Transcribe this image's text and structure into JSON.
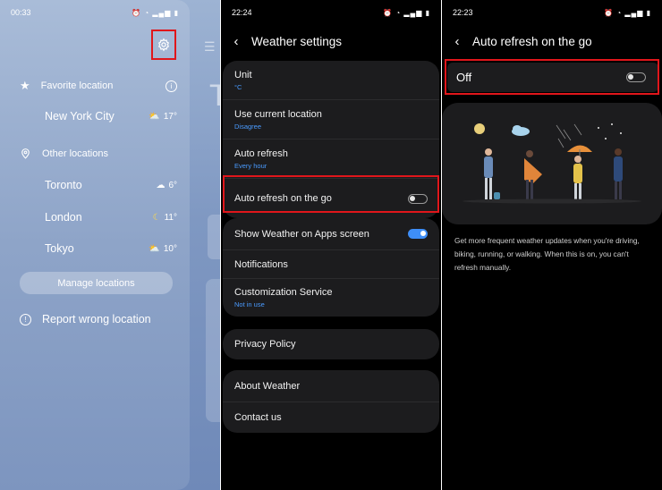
{
  "panel1": {
    "time": "00:33",
    "status_icons": "⏰ ◔ ▂▄▆ ▮",
    "favorite_label": "Favorite location",
    "favorite_city": "New York City",
    "favorite_temp": "17°",
    "other_label": "Other locations",
    "cities": [
      {
        "name": "Toronto",
        "temp": "6°",
        "icon": "cloud-icon"
      },
      {
        "name": "London",
        "temp": "11°",
        "icon": "moon-icon"
      },
      {
        "name": "Tokyo",
        "temp": "10°",
        "icon": "partly-cloudy-icon"
      }
    ],
    "manage_label": "Manage locations",
    "report_label": "Report wrong location"
  },
  "panel2": {
    "time": "22:24",
    "title": "Weather settings",
    "rows": [
      {
        "title": "Unit",
        "sub": "°C"
      },
      {
        "title": "Use current location",
        "sub": "Disagree"
      },
      {
        "title": "Auto refresh",
        "sub": "Every hour"
      },
      {
        "title": "Auto refresh on the go"
      }
    ],
    "show_on_apps": "Show Weather on Apps screen",
    "notifications": "Notifications",
    "customization": "Customization Service",
    "customization_sub": "Not in use",
    "privacy": "Privacy Policy",
    "about": "About Weather",
    "contact": "Contact us"
  },
  "panel3": {
    "time": "22:23",
    "title": "Auto refresh on the go",
    "off_label": "Off",
    "description": "Get more frequent weather updates when you're driving, biking, running, or walking. When this is on, you can't refresh manually."
  },
  "colors": {
    "accent": "#3e8ef7",
    "highlight": "#e0161b",
    "card": "#1c1c1e"
  }
}
